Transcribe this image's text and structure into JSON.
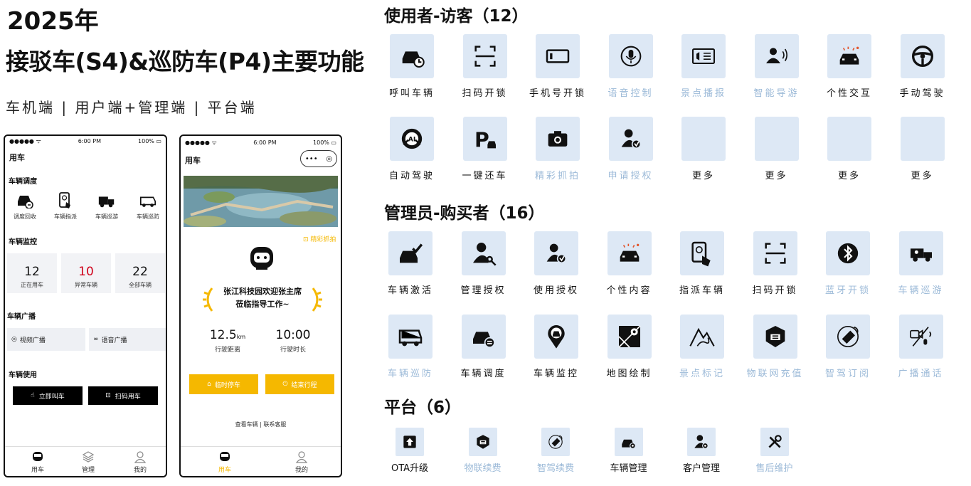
{
  "header": {
    "year": "2025年",
    "title": "接驳车(S4)&巡防车(P4)主要功能",
    "subtitle": "车机端 | 用户端+管理端 | 平台端"
  },
  "phone1": {
    "carrier": "●●●●● ᯤ",
    "time": "6:00 PM",
    "battery": "100% ▭",
    "title": "用车",
    "dispatch_title": "车辆调度",
    "dispatch_items": [
      "调度回收",
      "车辆指派",
      "车辆巡游",
      "车辆巡防"
    ],
    "monitor_title": "车辆监控",
    "stats": [
      {
        "num": "12",
        "label": "正在用车"
      },
      {
        "num": "10",
        "label": "异常车辆"
      },
      {
        "num": "22",
        "label": "全部车辆"
      }
    ],
    "broadcast_title": "车辆广播",
    "broadcast_items": [
      "视频广播",
      "语音广播"
    ],
    "use_title": "车辆使用",
    "use_buttons": [
      "立即叫车",
      "扫码用车"
    ],
    "tabs": [
      "用车",
      "管理",
      "我的"
    ]
  },
  "phone2": {
    "carrier": "●●●●● ᯤ",
    "time": "6:00 PM",
    "battery": "100% ▭",
    "title": "用车",
    "capture_link": "精彩抓拍",
    "welcome_line1": "张江科技园欢迎张主席",
    "welcome_line2": "莅临指导工作~",
    "distance_value": "12.5",
    "distance_unit": "km",
    "distance_label": "行驶距离",
    "duration_value": "10:00",
    "duration_label": "行驶时长",
    "btn_park": "临时停车",
    "btn_end": "结束行程",
    "footer_links": "查看车辆 | 联系客服",
    "tabs": [
      "用车",
      "我的"
    ]
  },
  "visitor": {
    "heading": "使用者-访客（12）",
    "items": [
      {
        "label": "呼叫车辆",
        "dim": false,
        "icon": "car-call-icon"
      },
      {
        "label": "扫码开锁",
        "dim": false,
        "icon": "scan-icon"
      },
      {
        "label": "手机号开锁",
        "dim": false,
        "icon": "phone-unlock-icon"
      },
      {
        "label": "语音控制",
        "dim": true,
        "icon": "microphone-icon"
      },
      {
        "label": "景点播报",
        "dim": true,
        "icon": "broadcast-card-icon"
      },
      {
        "label": "智能导游",
        "dim": true,
        "icon": "guide-voice-icon"
      },
      {
        "label": "个性交互",
        "dim": false,
        "icon": "car-sparkle-icon"
      },
      {
        "label": "手动驾驶",
        "dim": false,
        "icon": "steering-wheel-icon"
      },
      {
        "label": "自动驾驶",
        "dim": false,
        "icon": "ai-wheel-icon"
      },
      {
        "label": "一键还车",
        "dim": false,
        "icon": "parking-icon"
      },
      {
        "label": "精彩抓拍",
        "dim": true,
        "icon": "camera-icon"
      },
      {
        "label": "申请授权",
        "dim": true,
        "icon": "user-check-icon"
      },
      {
        "label": "更多",
        "dim": false,
        "icon": ""
      },
      {
        "label": "更多",
        "dim": false,
        "icon": ""
      },
      {
        "label": "更多",
        "dim": false,
        "icon": ""
      },
      {
        "label": "更多",
        "dim": false,
        "icon": ""
      }
    ]
  },
  "admin": {
    "heading": "管理员-购买者（16）",
    "items": [
      {
        "label": "车辆激活",
        "dim": false,
        "icon": "car-check-icon"
      },
      {
        "label": "管理授权",
        "dim": false,
        "icon": "user-key-icon"
      },
      {
        "label": "使用授权",
        "dim": false,
        "icon": "user-check-icon"
      },
      {
        "label": "个性内容",
        "dim": false,
        "icon": "car-sparkle-icon"
      },
      {
        "label": "指派车辆",
        "dim": false,
        "icon": "phone-tap-icon"
      },
      {
        "label": "扫码开锁",
        "dim": false,
        "icon": "scan-icon"
      },
      {
        "label": "蓝牙开锁",
        "dim": true,
        "icon": "bluetooth-icon"
      },
      {
        "label": "车辆巡游",
        "dim": true,
        "icon": "truck-icon"
      },
      {
        "label": "车辆巡防",
        "dim": true,
        "icon": "patrol-car-icon"
      },
      {
        "label": "车辆调度",
        "dim": false,
        "icon": "car-dispatch-icon"
      },
      {
        "label": "车辆监控",
        "dim": false,
        "icon": "car-pin-icon"
      },
      {
        "label": "地图绘制",
        "dim": false,
        "icon": "map-icon"
      },
      {
        "label": "景点标记",
        "dim": true,
        "icon": "mountain-path-icon"
      },
      {
        "label": "物联网充值",
        "dim": true,
        "icon": "iot-chip-icon"
      },
      {
        "label": "智驾订阅",
        "dim": true,
        "icon": "satellite-car-icon"
      },
      {
        "label": "广播通话",
        "dim": true,
        "icon": "broadcast-call-icon"
      }
    ]
  },
  "platform": {
    "heading": "平台（6）",
    "items": [
      {
        "label": "OTA升级",
        "dim": false,
        "icon": "upload-icon"
      },
      {
        "label": "物联续费",
        "dim": true,
        "icon": "iot-chip-icon"
      },
      {
        "label": "智驾续费",
        "dim": true,
        "icon": "satellite-car-icon"
      },
      {
        "label": "车辆管理",
        "dim": false,
        "icon": "car-gear-icon"
      },
      {
        "label": "客户管理",
        "dim": false,
        "icon": "user-gear-icon"
      },
      {
        "label": "售后维护",
        "dim": true,
        "icon": "tools-icon"
      }
    ]
  },
  "colors": {
    "tile_bg": "#dde8f5",
    "dim_label": "#9cbad8",
    "accent_yellow": "#f5b800",
    "alert_red": "#d0021b"
  }
}
